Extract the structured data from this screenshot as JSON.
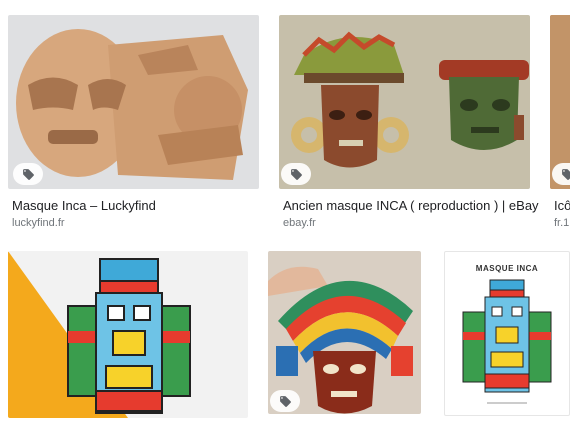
{
  "results": [
    {
      "title": "Masque Inca – Luckyfind",
      "source": "luckyfind.fr",
      "thumb_bg": "#dfe0e2",
      "icon": "shopping-tag-icon"
    },
    {
      "title": "Ancien masque INCA ( reproduction ) | eBay",
      "source": "ebay.fr",
      "thumb_bg": "#c6bfaa",
      "icon": "shopping-tag-icon"
    },
    {
      "title": "Icô",
      "source": "fr.1",
      "thumb_bg": "#b98c62",
      "icon": "shopping-tag-icon"
    },
    {
      "thumb_bg": "#f4a91c",
      "icon": "shopping-tag-icon"
    },
    {
      "thumb_bg": "#d9cfc3",
      "icon": "shopping-tag-icon"
    },
    {
      "poster_title": "MASQUE INCA",
      "thumb_bg": "#ffffff"
    }
  ],
  "colors": {
    "tag_icon": "#5f6368",
    "source_text": "#70757a"
  }
}
